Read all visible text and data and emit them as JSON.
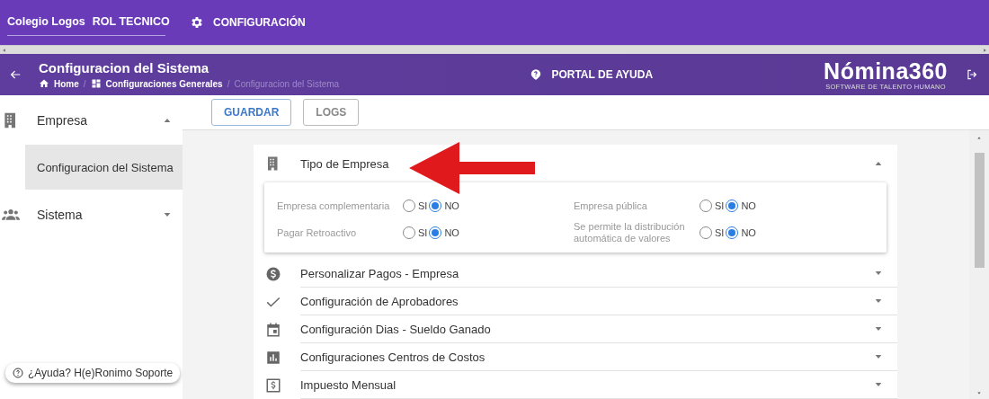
{
  "topbar": {
    "school": "Colegio Logos",
    "role": "ROL TECNICO",
    "menu": "CONFIGURACIÓN"
  },
  "header": {
    "title": "Configuracion del Sistema",
    "breadcrumbs": [
      {
        "label": "Home",
        "current": false
      },
      {
        "label": "Configuraciones Generales",
        "current": false
      },
      {
        "label": "Configuracion del Sistema",
        "current": true
      }
    ],
    "separators": [
      "/",
      "/"
    ],
    "help": "PORTAL DE AYUDA",
    "logo": "Nómina360",
    "tagline": "SOFTWARE DE TALENTO HUMANO"
  },
  "sidebar": {
    "items": [
      {
        "label": "Empresa",
        "expanded": true,
        "children": [
          {
            "label": "Configuracion del Sistema",
            "selected": true
          }
        ]
      },
      {
        "label": "Sistema",
        "expanded": false
      }
    ]
  },
  "help_chip": "¿Ayuda? H(e)Ronimo Soporte",
  "toolbar": [
    {
      "label": "GUARDAR",
      "kind": "primary"
    },
    {
      "label": "LOGS",
      "kind": "secondary"
    }
  ],
  "sections": [
    {
      "label": "Tipo de Empresa",
      "expanded": true,
      "fields": [
        {
          "label": "Empresa complementaria",
          "options": [
            {
              "label": "SI",
              "selected": false
            },
            {
              "label": "NO",
              "selected": true
            }
          ]
        },
        {
          "label": "Pagar Retroactivo",
          "options": [
            {
              "label": "SI",
              "selected": false
            },
            {
              "label": "NO",
              "selected": true
            }
          ]
        },
        {
          "label": "Empresa pública",
          "options": [
            {
              "label": "SI",
              "selected": false
            },
            {
              "label": "NO",
              "selected": true
            }
          ]
        },
        {
          "label": "Se permite la distribución automática de valores",
          "options": [
            {
              "label": "SI",
              "selected": false
            },
            {
              "label": "NO",
              "selected": true
            }
          ]
        }
      ]
    },
    {
      "label": "Personalizar Pagos - Empresa",
      "expanded": false
    },
    {
      "label": "Configuración de Aprobadores",
      "expanded": false
    },
    {
      "label": "Configuración Dias - Sueldo Ganado",
      "expanded": false
    },
    {
      "label": "Configuraciones Centros de Costos",
      "expanded": false
    },
    {
      "label": "Impuesto Mensual",
      "expanded": false
    }
  ]
}
